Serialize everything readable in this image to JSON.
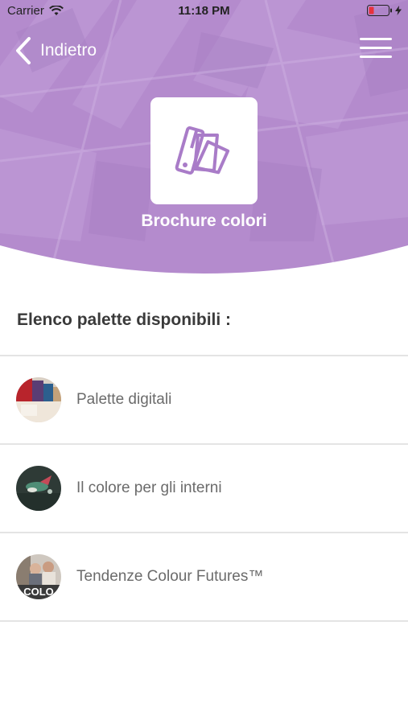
{
  "status": {
    "carrier": "Carrier",
    "time": "11:18 PM"
  },
  "nav": {
    "back_label": "Indietro"
  },
  "header": {
    "app_title": "Brochure colori",
    "accent_color": "#b58dcf"
  },
  "section": {
    "title": "Elenco palette disponibili :"
  },
  "palettes": [
    {
      "label": "Palette digitali",
      "thumb": "palette-digitali-thumbnail"
    },
    {
      "label": "Il colore per gli interni",
      "thumb": "colore-interni-thumbnail"
    },
    {
      "label": "Tendenze Colour Futures™",
      "thumb": "colour-futures-thumbnail",
      "thumb_text": "COLO"
    }
  ]
}
